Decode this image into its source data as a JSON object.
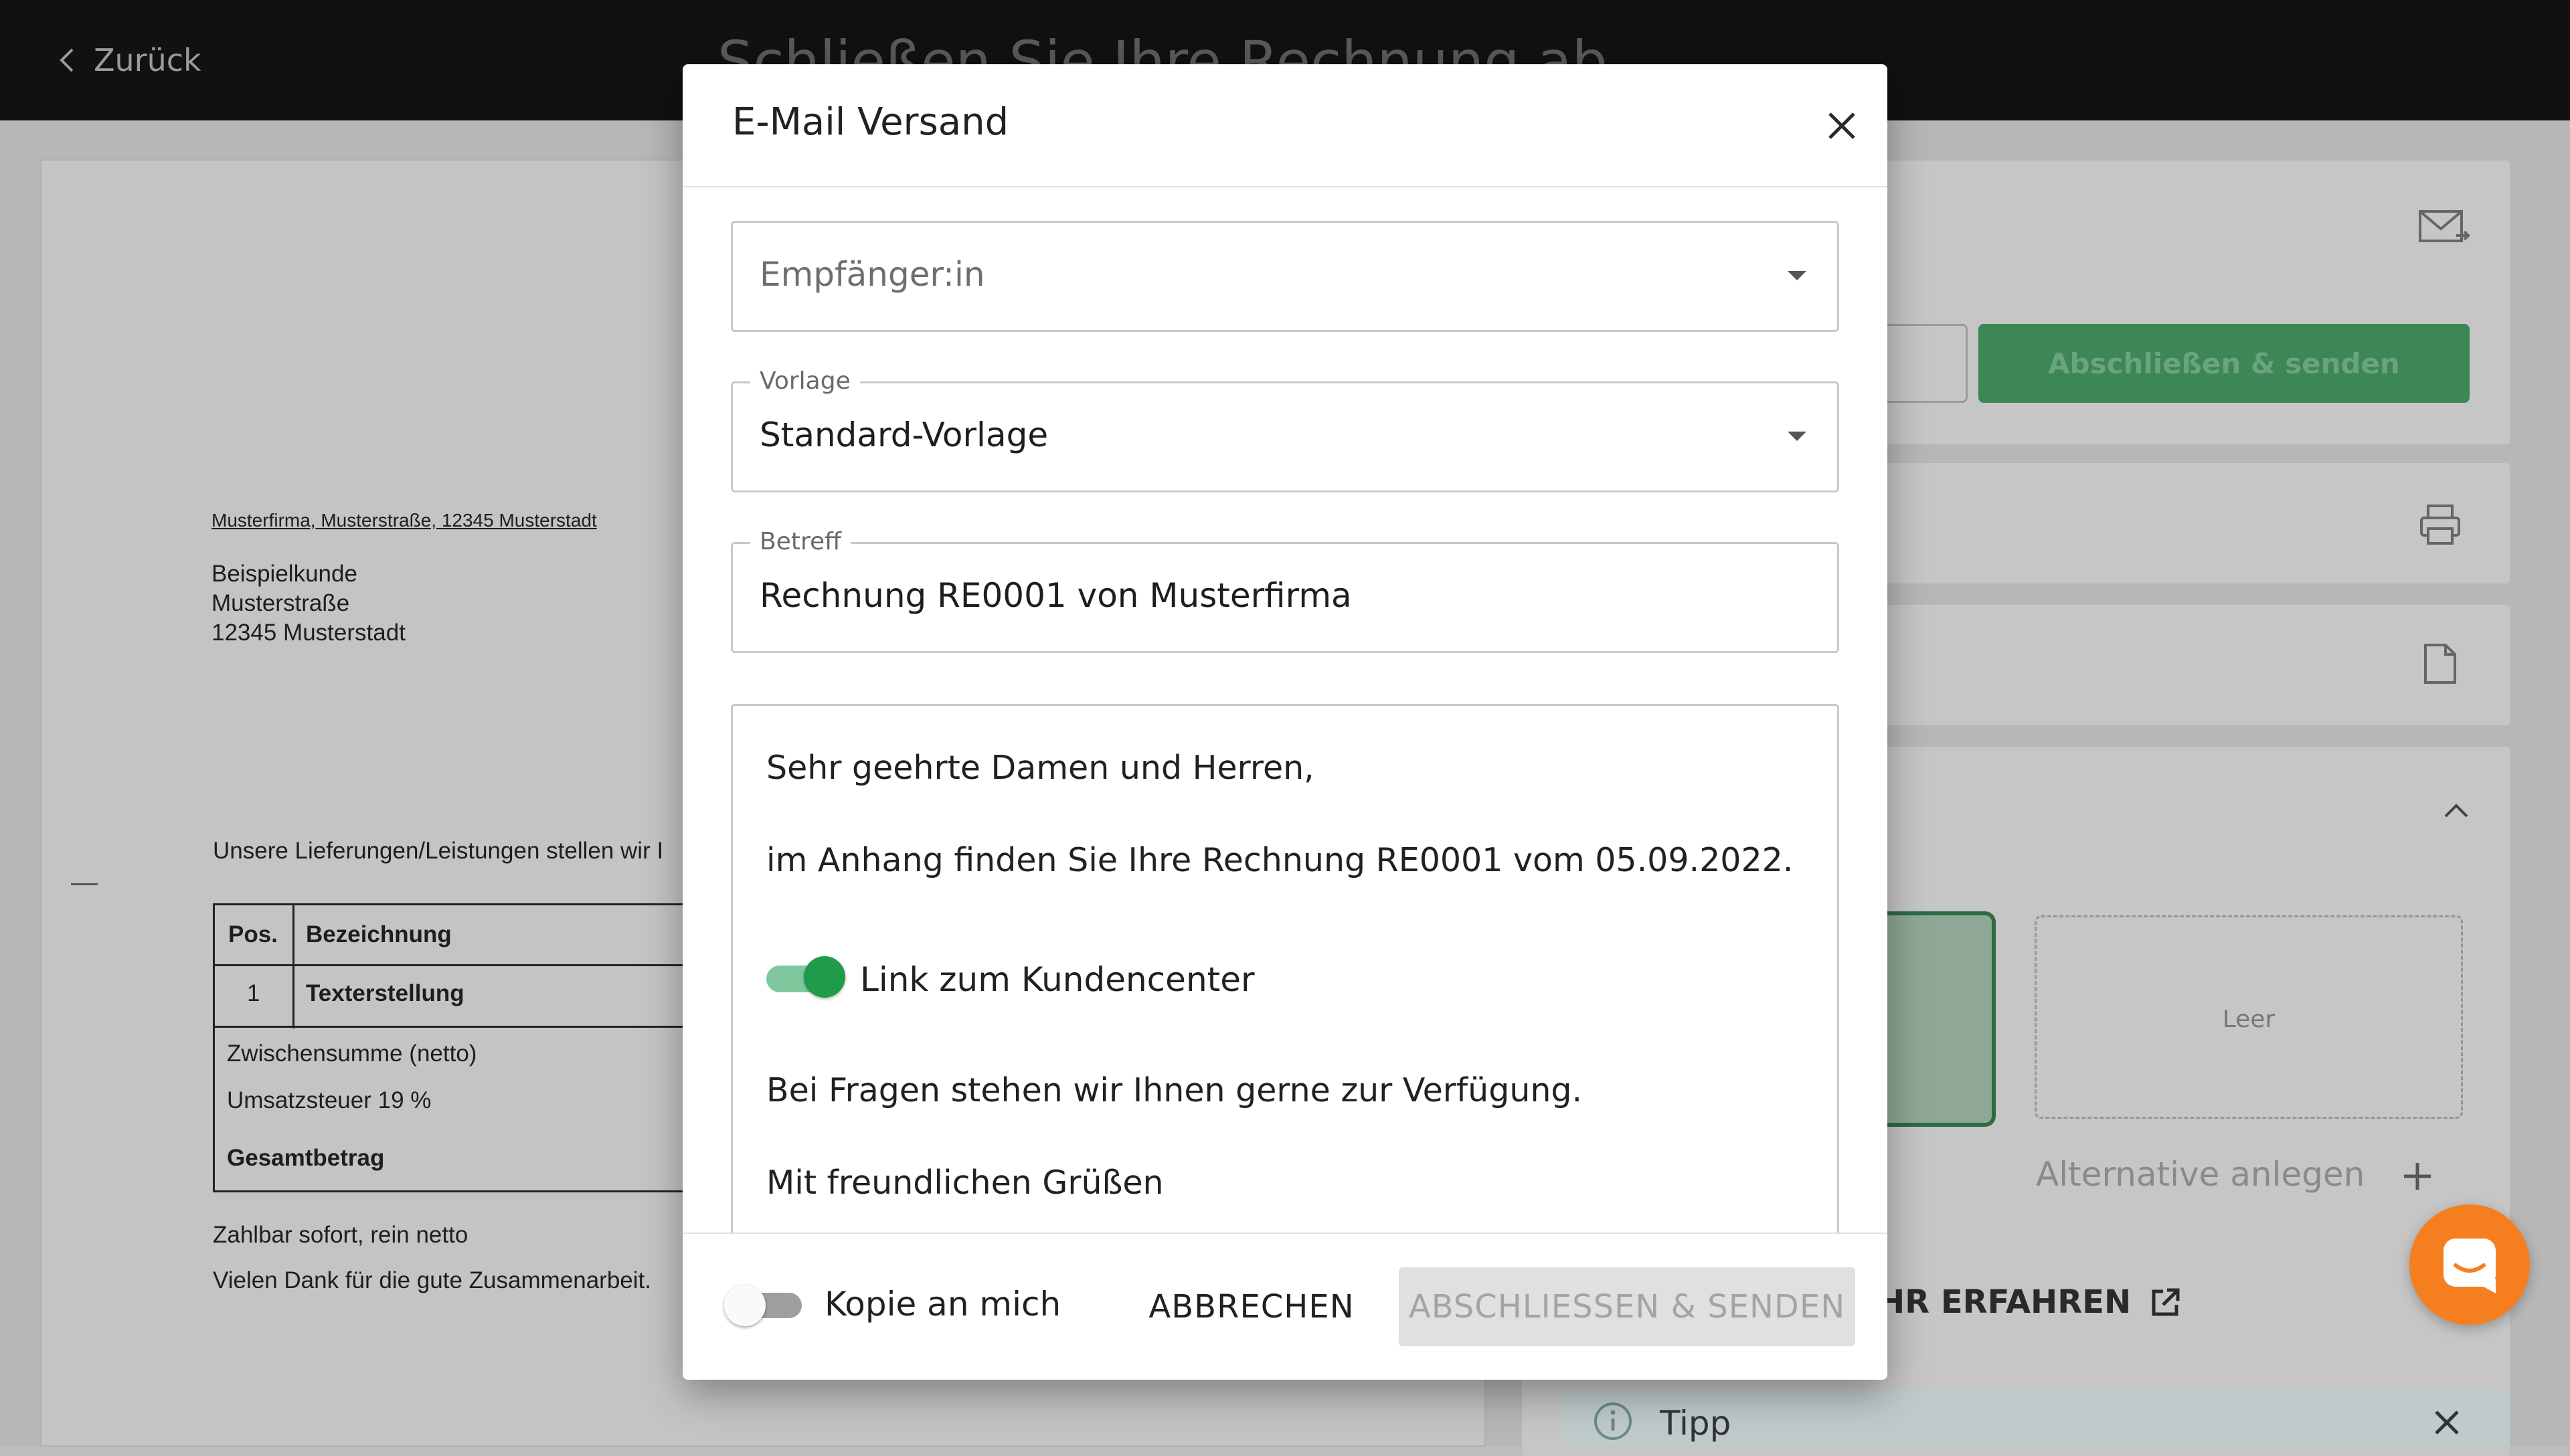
{
  "app": {
    "back_label": "Zurück",
    "page_title": "Schließen Sie Ihre Rechnung ab"
  },
  "invoice": {
    "sender_line": "Musterfirma, Musterstraße, 12345 Musterstadt",
    "recipient": [
      "Beispielkunde",
      "Musterstraße",
      "12345 Musterstadt"
    ],
    "intro": "Unsere Lieferungen/Leistungen stellen wir I",
    "table": {
      "col_pos": "Pos.",
      "col_desc": "Bezeichnung",
      "row_pos": "1",
      "row_desc": "Texterstellung",
      "subtotal": "Zwischensumme (netto)",
      "vat": "Umsatzsteuer 19 %",
      "total": "Gesamtbetrag"
    },
    "payment": "Zahlbar sofort, rein netto",
    "thanks": "Vielen Dank für die gute Zusammenarbeit."
  },
  "side": {
    "send_button": "Abschließen & senden",
    "empty_template": "Leer",
    "add_alternative": "Alternative anlegen",
    "learn_more": "HR ERFAHREN",
    "tip": "Tipp"
  },
  "modal": {
    "title": "E-Mail Versand",
    "recipient_placeholder": "Empfänger:in",
    "template_label": "Vorlage",
    "template_value": "Standard-Vorlage",
    "subject_label": "Betreff",
    "subject_value": "Rechnung RE0001 von Musterfirma",
    "body": {
      "greeting": "Sehr geehrte Damen und Herren,",
      "line1": "im Anhang finden Sie Ihre Rechnung RE0001 vom 05.09.2022.",
      "link_toggle_label": "Link zum Kundencenter",
      "link_toggle_on": true,
      "line2": "Bei Fragen stehen wir Ihnen gerne zur Verfügung.",
      "closing": "Mit freundlichen Grüßen"
    },
    "copy_toggle_label": "Kopie an mich",
    "copy_toggle_on": false,
    "cancel_label": "ABBRECHEN",
    "send_label": "ABSCHLIESSEN & SENDEN"
  },
  "colors": {
    "accent_green": "#1f9b4a",
    "chat_orange": "#f57f1f"
  }
}
